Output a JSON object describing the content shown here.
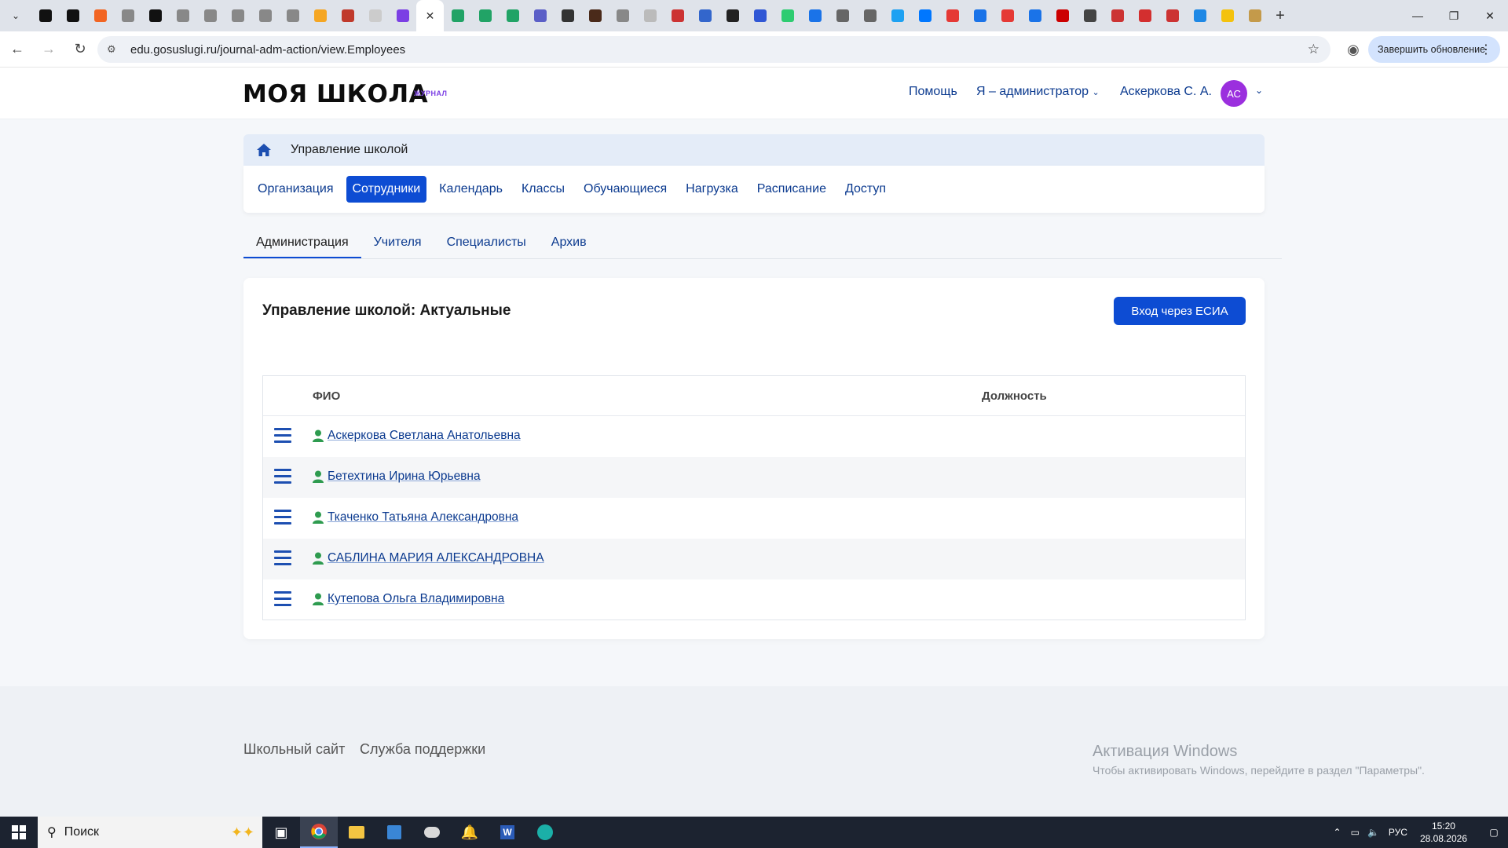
{
  "browser": {
    "url": "edu.gosuslugi.ru/journal-adm-action/view.Employees",
    "update_label": "Завершить обновление",
    "tab_favicon_colors": [
      "#111111",
      "#111111",
      "#f26522",
      "#888888",
      "#111111",
      "#888888",
      "#888888",
      "#888888",
      "#888888",
      "#888888",
      "#f5a623",
      "#c0392b",
      "#cccccc",
      "#7b3fe4",
      "#ffffff",
      "#21a366",
      "#21a366",
      "#21a366",
      "#5b5fc7",
      "#333333",
      "#4a2a1a",
      "#888888",
      "#bbbbbb",
      "#cc3333",
      "#3366cc",
      "#222222",
      "#3057d5",
      "#2ecc71",
      "#1a73e8",
      "#666666",
      "#666666",
      "#1da1f2",
      "#0077ff",
      "#e53935",
      "#1a73e8",
      "#e53935",
      "#1a73e8",
      "#cc0000",
      "#444444",
      "#cc3333",
      "#d32f2f",
      "#cc3333",
      "#1e88e5",
      "#f4c20d",
      "#c49a4a"
    ]
  },
  "header": {
    "logo": "МОЯ ШКОЛА",
    "logo_sub": "ЖУРНАЛ",
    "help": "Помощь",
    "role": "Я – администратор",
    "user": "Аскеркова С. А.",
    "avatar": "АС"
  },
  "breadcrumb": {
    "label": "Управление школой"
  },
  "nav": {
    "items": [
      "Организация",
      "Сотрудники",
      "Календарь",
      "Классы",
      "Обучающиеся",
      "Нагрузка",
      "Расписание",
      "Доступ"
    ],
    "active_index": 1
  },
  "subtabs": {
    "items": [
      "Администрация",
      "Учителя",
      "Специалисты",
      "Архив"
    ],
    "active_index": 0
  },
  "card": {
    "title": "Управление школой: Актуальные",
    "esia_button": "Вход через ЕСИА"
  },
  "table": {
    "headers": {
      "name": "ФИО",
      "position": "Должность"
    },
    "rows": [
      {
        "name": "Аскеркова Светлана Анатольевна",
        "position": ""
      },
      {
        "name": "Бетехтина Ирина Юрьевна",
        "position": ""
      },
      {
        "name": "Ткаченко Татьяна Александровна",
        "position": ""
      },
      {
        "name": "САБЛИНА МАРИЯ АЛЕКСАНДРОВНА",
        "position": ""
      },
      {
        "name": "Кутепова Ольга Владимировна",
        "position": ""
      }
    ]
  },
  "footer": {
    "school_site": "Школьный сайт",
    "support": "Служба поддержки",
    "watermark_title": "Активация Windows",
    "watermark_text": "Чтобы активировать Windows, перейдите в раздел \"Параметры\"."
  },
  "taskbar": {
    "search_placeholder": "Поиск",
    "lang": "РУС",
    "time": "15:20",
    "date": "28.08.2026"
  },
  "colors": {
    "primary": "#0d4cd3",
    "link": "#0b3a8f",
    "user_icon": "#2e9b4f",
    "avatar": "#9b2fde"
  }
}
